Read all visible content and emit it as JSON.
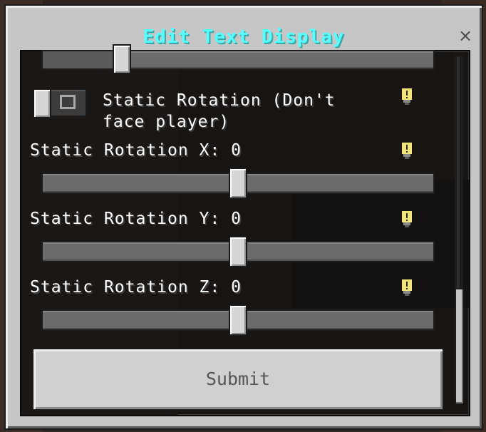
{
  "dialog": {
    "title": "Edit Text Display",
    "close_glyph": "×"
  },
  "settings": [
    {
      "label": "Static Rotation (Don't",
      "label_line2": "face player)",
      "type": "toggle",
      "value": false
    },
    {
      "label": "Static Rotation X: 0",
      "type": "slider",
      "value": 0.5
    },
    {
      "label": "Static Rotation Y: 0",
      "type": "slider",
      "value": 0.5
    },
    {
      "label": "Static Rotation Z: 0",
      "type": "slider",
      "value": 0.5
    }
  ],
  "partial_slider_value": 0.19,
  "submit_label": "Submit",
  "icons": {
    "info": "lightbulb-info-icon",
    "close": "close-icon"
  },
  "colors": {
    "title": "#55ffff",
    "info_icon": "#f2e37a",
    "panel": "#c6c6c6",
    "content_bg": "#171412"
  }
}
